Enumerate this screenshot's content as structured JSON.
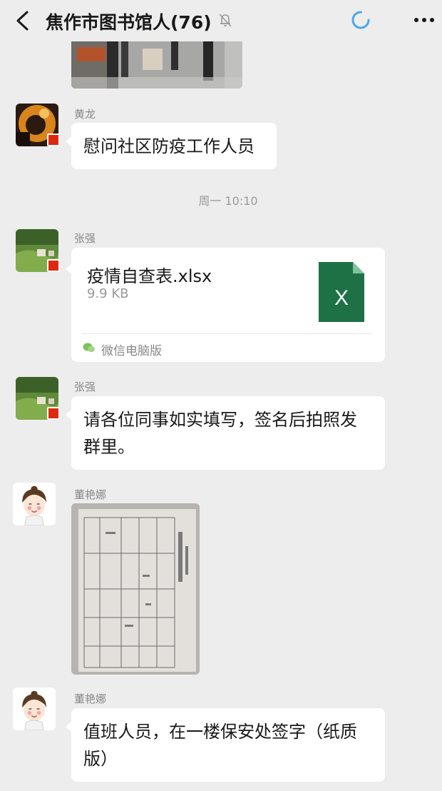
{
  "header": {
    "title": "焦作市图书馆人(76)"
  },
  "messages": [
    {
      "sender": "黄龙",
      "text": "慰问社区防疫工作人员"
    },
    {
      "timestamp": "周一 10:10"
    },
    {
      "sender": "张强",
      "file": {
        "name": "疫情自查表.xlsx",
        "size": "9.9 KB",
        "icon_letter": "X",
        "source": "微信电脑版"
      }
    },
    {
      "sender": "张强",
      "text_lines": [
        "请各位同事如实填写，签名后拍照发",
        "群里。"
      ]
    },
    {
      "sender": "董艳娜",
      "image": "document-photo"
    },
    {
      "sender": "董艳娜",
      "text_lines": [
        "值班人员，在一楼保安处签字（纸质",
        "版）"
      ]
    }
  ],
  "colors": {
    "background": "#ededed",
    "bubble": "#ffffff",
    "excel_green": "#1e7145",
    "spinner_blue": "#4aa8e8"
  }
}
